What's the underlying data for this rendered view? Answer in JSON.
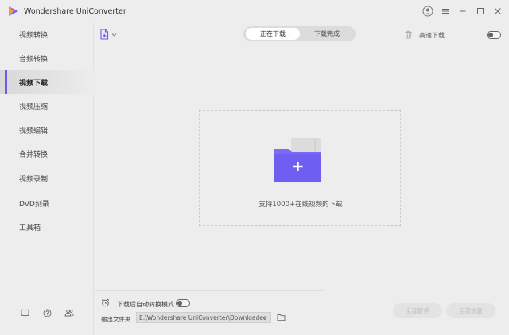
{
  "app": {
    "title": "Wondershare UniConverter"
  },
  "sidebar": {
    "items": [
      {
        "label": "视频转换",
        "active": false
      },
      {
        "label": "音频转换",
        "active": false
      },
      {
        "label": "视频下载",
        "active": true
      },
      {
        "label": "视频压缩",
        "active": false
      },
      {
        "label": "视频编辑",
        "active": false
      },
      {
        "label": "合并转换",
        "active": false
      },
      {
        "label": "视频录制",
        "active": false
      },
      {
        "label": "DVD刻录",
        "active": false
      },
      {
        "label": "工具箱",
        "active": false
      }
    ],
    "bottom_icons": [
      "book-icon",
      "help-icon",
      "people-icon"
    ]
  },
  "toolbar": {
    "tabs": [
      {
        "label": "正在下载",
        "selected": true
      },
      {
        "label": "下载完成",
        "selected": false
      }
    ],
    "high_speed_label": "高速下载",
    "high_speed_enabled": false
  },
  "drop_zone": {
    "text": "支持1000+在线视频的下载"
  },
  "footer": {
    "auto_convert_label": "下载后自动转换模式",
    "auto_convert_enabled": false,
    "output_label": "输出文件夹",
    "output_path": "E:\\Wondershare UniConverter\\Downloaded",
    "pause_all_label": "全部暂停",
    "resume_all_label": "全部恢复"
  },
  "colors": {
    "accent": "#6b5bf0",
    "folder_front": "#7b6cf6",
    "folder_back": "#d9d9d9"
  }
}
